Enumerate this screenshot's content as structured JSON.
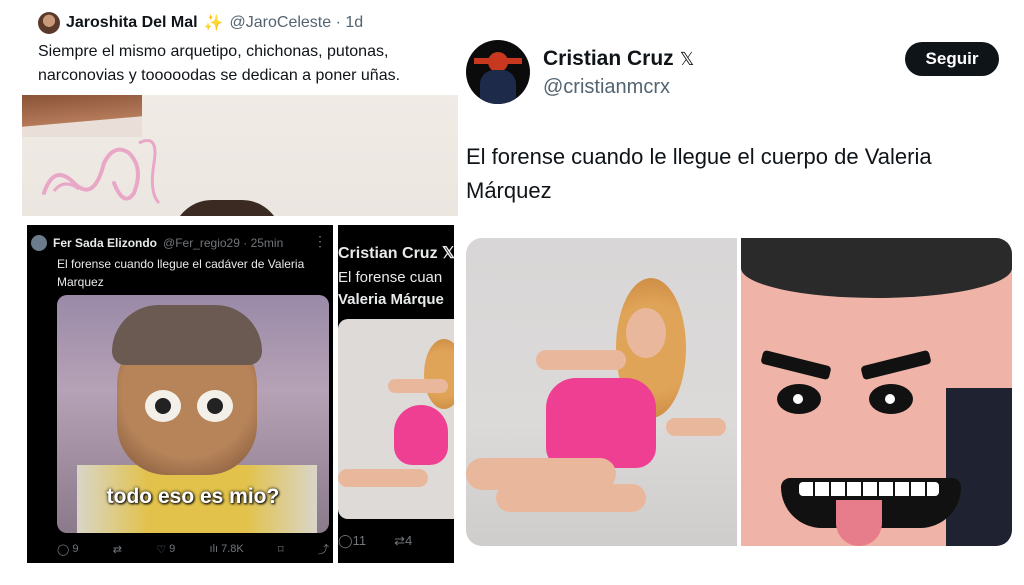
{
  "tweet_top": {
    "author_name": "Jaroshita Del Mal",
    "name_emoji": "✨",
    "handle_time": "@JaroCeleste · 1d",
    "text": "Siempre el mismo arquetipo, chichonas, putonas, narconovias y tooooodas se dedican a poner uñas."
  },
  "tweet_dark": {
    "author_name": "Fer Sada Elizondo",
    "handle_time": "@Fer_regio29 · 25min",
    "more": "⋮",
    "text": "El forense cuando llegue el cadáver de Valeria Marquez",
    "image_caption": "todo eso es mio?",
    "actions": {
      "replies": "9",
      "retweets": "",
      "likes": "9",
      "views": "7.8K"
    }
  },
  "tweet_cropped": {
    "author_name": "Cristian Cruz",
    "x_badge": "𝕏",
    "text_line1": "El forense cuan",
    "text_line2": "Valeria Márque",
    "actions": {
      "replies": "11",
      "retweets": "4"
    }
  },
  "tweet_main": {
    "author_name": "Cristian Cruz",
    "x_badge": "𝕏",
    "handle": "@cristianmcrx",
    "follow_label": "Seguir",
    "text": "El forense cuando le llegue el cuerpo de Valeria Márquez"
  },
  "icons": {
    "reply": "◯",
    "retweet": "⇄",
    "like": "♡",
    "views": "ılı",
    "bookmark": "⌑",
    "share": "⤴"
  },
  "colors": {
    "accent_dark": "#0f1419",
    "muted": "#536471",
    "swimsuit_pink": "#ee3f93"
  }
}
